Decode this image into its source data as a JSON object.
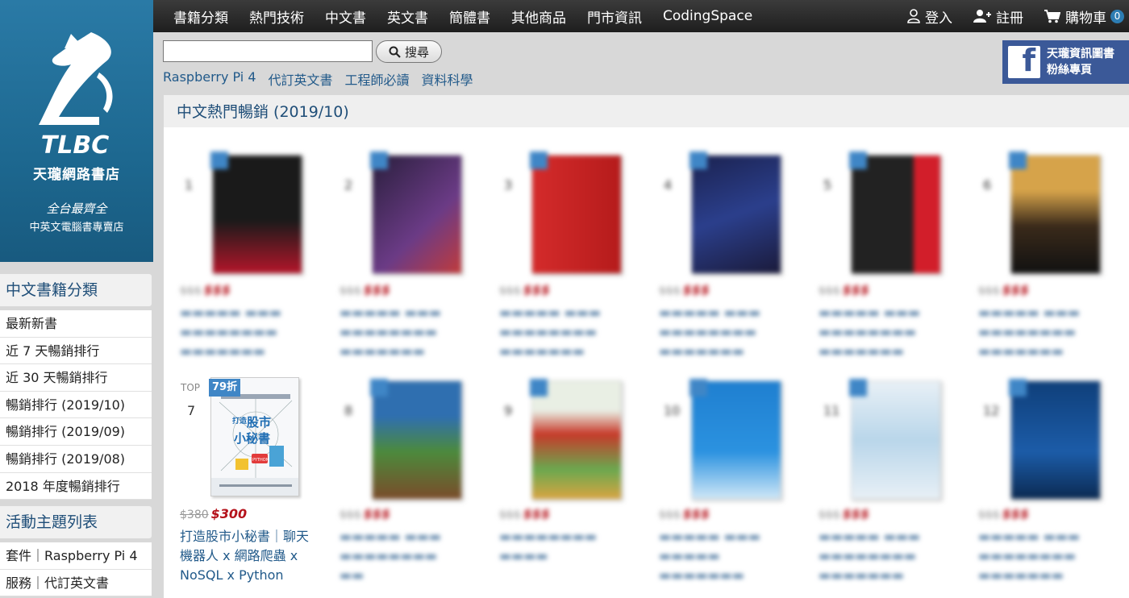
{
  "logo": {
    "store_name": "天瓏網路書店",
    "slogan": "全台最齊全",
    "subtitle": "中英文電腦書專賣店",
    "mark_text": "TLBC",
    "brand_color": "#1d6b96"
  },
  "topnav": {
    "menu": [
      "書籍分類",
      "熱門技術",
      "中文書",
      "英文書",
      "簡體書",
      "其他商品",
      "門市資訊",
      "CodingSpace"
    ],
    "login": "登入",
    "register": "註冊",
    "cart": "購物車",
    "cart_count": "0"
  },
  "search": {
    "value": "",
    "button": "搜尋"
  },
  "quick_links": [
    "Raspberry Pi 4",
    "代訂英文書",
    "工程師必讀",
    "資料科學"
  ],
  "facebook": {
    "line1": "天瓏資訊圖書",
    "line2": "粉絲專頁",
    "icon": "facebook-icon",
    "color": "#3b5998"
  },
  "sidebar": {
    "categories_title": "中文書籍分類",
    "categories": [
      "最新新書",
      "近 7 天暢銷排行",
      "近 30 天暢銷排行",
      "暢銷排行 (2019/10)",
      "暢銷排行 (2019/09)",
      "暢銷排行 (2019/08)",
      "2018 年度暢銷排行"
    ],
    "events_title": "活動主題列表",
    "events": [
      "套件｜Raspberry Pi 4",
      "服務｜代訂英文書"
    ]
  },
  "main": {
    "heading": "中文熱門暢銷 (2019/10)",
    "featured_book": {
      "rank_label": "TOP",
      "rank": "7",
      "discount": "79折",
      "original_price": "$380",
      "sale_price": "$300",
      "title": "打造股市小秘書｜聊天機器人 x 網路爬蟲 x NoSQL x Python",
      "cover_title": "股市小秘書",
      "cover_prefix": "打造",
      "cover_tag": "PYTHON"
    }
  }
}
